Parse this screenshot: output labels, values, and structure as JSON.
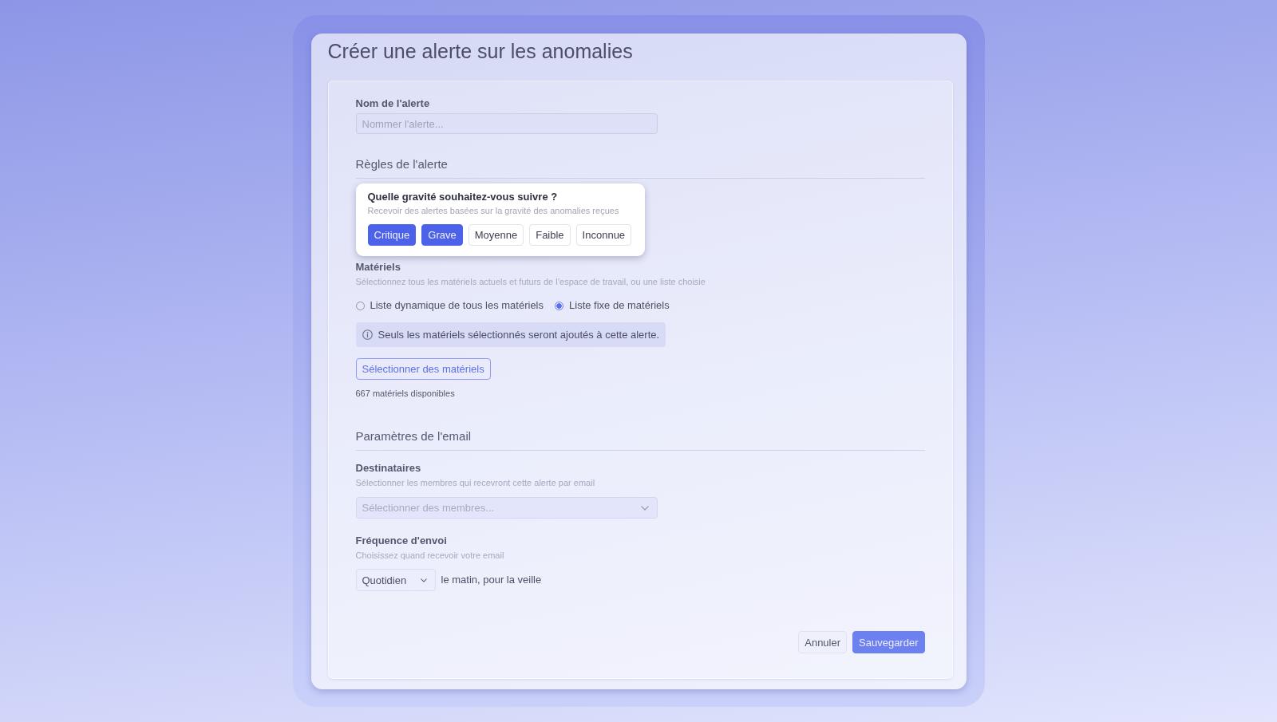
{
  "window": {
    "title": "Créer une alerte sur les anomalies"
  },
  "form": {
    "alert_name": {
      "label": "Nom de l'alerte",
      "placeholder": "Nommer l'alerte..."
    },
    "rules": {
      "heading": "Règles de l'alerte",
      "severity": {
        "question": "Quelle gravité souhaitez-vous suivre ?",
        "hint": "Recevoir des alertes basées sur la gravité des anomalies reçues",
        "options": [
          {
            "label": "Critique",
            "selected": true
          },
          {
            "label": "Grave",
            "selected": true
          },
          {
            "label": "Moyenne",
            "selected": false
          },
          {
            "label": "Faible",
            "selected": false
          },
          {
            "label": "Inconnue",
            "selected": false
          }
        ]
      },
      "assets": {
        "label": "Matériels",
        "hint": "Sélectionnez tous les matériels actuels et futurs de l’espace de travail, ou une liste choisie",
        "radios": [
          {
            "label": "Liste dynamique de tous les matériels",
            "selected": false
          },
          {
            "label": "Liste fixe de matériels",
            "selected": true
          }
        ],
        "notice": "Seuls les matériels sélectionnés seront ajoutés à cette alerte.",
        "select_button": "Sélectionner des matériels",
        "count": "667 matériels disponibles"
      }
    },
    "email": {
      "heading": "Paramètres de l'email",
      "recipients": {
        "label": "Destinataires",
        "hint": "Sélectionner les membres qui recevront cette alerte par email",
        "placeholder": "Sélectionner des membres..."
      },
      "frequency": {
        "label": "Fréquence d'envoi",
        "hint": "Choisissez quand recevoir votre email",
        "value": "Quotidien",
        "suffix": "le matin, pour la veille"
      }
    }
  },
  "actions": [
    {
      "label": "Annuler",
      "kind": "secondary"
    },
    {
      "label": "Sauvegarder",
      "kind": "primary"
    }
  ]
}
